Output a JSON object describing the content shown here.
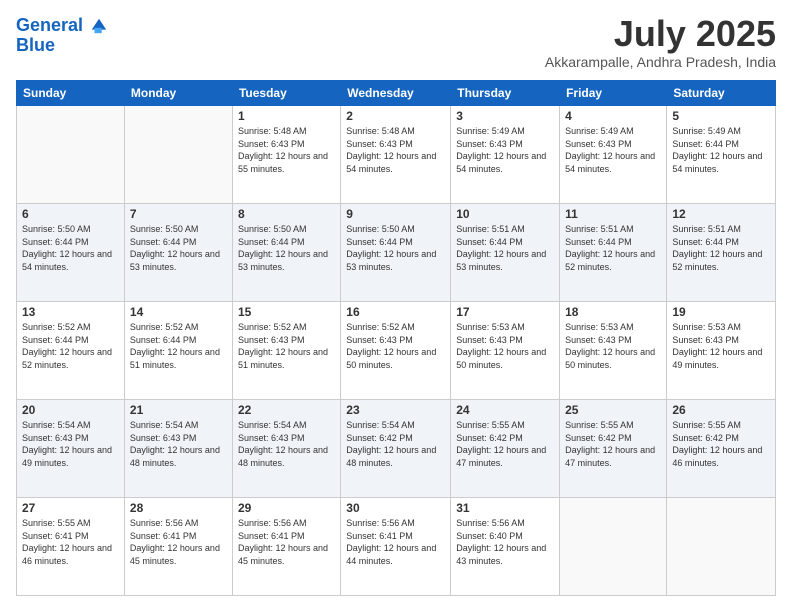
{
  "header": {
    "logo_line1": "General",
    "logo_line2": "Blue",
    "month_title": "July 2025",
    "location": "Akkarampalle, Andhra Pradesh, India"
  },
  "days_of_week": [
    "Sunday",
    "Monday",
    "Tuesday",
    "Wednesday",
    "Thursday",
    "Friday",
    "Saturday"
  ],
  "weeks": [
    [
      {
        "day": "",
        "info": ""
      },
      {
        "day": "",
        "info": ""
      },
      {
        "day": "1",
        "info": "Sunrise: 5:48 AM\nSunset: 6:43 PM\nDaylight: 12 hours and 55 minutes."
      },
      {
        "day": "2",
        "info": "Sunrise: 5:48 AM\nSunset: 6:43 PM\nDaylight: 12 hours and 54 minutes."
      },
      {
        "day": "3",
        "info": "Sunrise: 5:49 AM\nSunset: 6:43 PM\nDaylight: 12 hours and 54 minutes."
      },
      {
        "day": "4",
        "info": "Sunrise: 5:49 AM\nSunset: 6:43 PM\nDaylight: 12 hours and 54 minutes."
      },
      {
        "day": "5",
        "info": "Sunrise: 5:49 AM\nSunset: 6:44 PM\nDaylight: 12 hours and 54 minutes."
      }
    ],
    [
      {
        "day": "6",
        "info": "Sunrise: 5:50 AM\nSunset: 6:44 PM\nDaylight: 12 hours and 54 minutes."
      },
      {
        "day": "7",
        "info": "Sunrise: 5:50 AM\nSunset: 6:44 PM\nDaylight: 12 hours and 53 minutes."
      },
      {
        "day": "8",
        "info": "Sunrise: 5:50 AM\nSunset: 6:44 PM\nDaylight: 12 hours and 53 minutes."
      },
      {
        "day": "9",
        "info": "Sunrise: 5:50 AM\nSunset: 6:44 PM\nDaylight: 12 hours and 53 minutes."
      },
      {
        "day": "10",
        "info": "Sunrise: 5:51 AM\nSunset: 6:44 PM\nDaylight: 12 hours and 53 minutes."
      },
      {
        "day": "11",
        "info": "Sunrise: 5:51 AM\nSunset: 6:44 PM\nDaylight: 12 hours and 52 minutes."
      },
      {
        "day": "12",
        "info": "Sunrise: 5:51 AM\nSunset: 6:44 PM\nDaylight: 12 hours and 52 minutes."
      }
    ],
    [
      {
        "day": "13",
        "info": "Sunrise: 5:52 AM\nSunset: 6:44 PM\nDaylight: 12 hours and 52 minutes."
      },
      {
        "day": "14",
        "info": "Sunrise: 5:52 AM\nSunset: 6:44 PM\nDaylight: 12 hours and 51 minutes."
      },
      {
        "day": "15",
        "info": "Sunrise: 5:52 AM\nSunset: 6:43 PM\nDaylight: 12 hours and 51 minutes."
      },
      {
        "day": "16",
        "info": "Sunrise: 5:52 AM\nSunset: 6:43 PM\nDaylight: 12 hours and 50 minutes."
      },
      {
        "day": "17",
        "info": "Sunrise: 5:53 AM\nSunset: 6:43 PM\nDaylight: 12 hours and 50 minutes."
      },
      {
        "day": "18",
        "info": "Sunrise: 5:53 AM\nSunset: 6:43 PM\nDaylight: 12 hours and 50 minutes."
      },
      {
        "day": "19",
        "info": "Sunrise: 5:53 AM\nSunset: 6:43 PM\nDaylight: 12 hours and 49 minutes."
      }
    ],
    [
      {
        "day": "20",
        "info": "Sunrise: 5:54 AM\nSunset: 6:43 PM\nDaylight: 12 hours and 49 minutes."
      },
      {
        "day": "21",
        "info": "Sunrise: 5:54 AM\nSunset: 6:43 PM\nDaylight: 12 hours and 48 minutes."
      },
      {
        "day": "22",
        "info": "Sunrise: 5:54 AM\nSunset: 6:43 PM\nDaylight: 12 hours and 48 minutes."
      },
      {
        "day": "23",
        "info": "Sunrise: 5:54 AM\nSunset: 6:42 PM\nDaylight: 12 hours and 48 minutes."
      },
      {
        "day": "24",
        "info": "Sunrise: 5:55 AM\nSunset: 6:42 PM\nDaylight: 12 hours and 47 minutes."
      },
      {
        "day": "25",
        "info": "Sunrise: 5:55 AM\nSunset: 6:42 PM\nDaylight: 12 hours and 47 minutes."
      },
      {
        "day": "26",
        "info": "Sunrise: 5:55 AM\nSunset: 6:42 PM\nDaylight: 12 hours and 46 minutes."
      }
    ],
    [
      {
        "day": "27",
        "info": "Sunrise: 5:55 AM\nSunset: 6:41 PM\nDaylight: 12 hours and 46 minutes."
      },
      {
        "day": "28",
        "info": "Sunrise: 5:56 AM\nSunset: 6:41 PM\nDaylight: 12 hours and 45 minutes."
      },
      {
        "day": "29",
        "info": "Sunrise: 5:56 AM\nSunset: 6:41 PM\nDaylight: 12 hours and 45 minutes."
      },
      {
        "day": "30",
        "info": "Sunrise: 5:56 AM\nSunset: 6:41 PM\nDaylight: 12 hours and 44 minutes."
      },
      {
        "day": "31",
        "info": "Sunrise: 5:56 AM\nSunset: 6:40 PM\nDaylight: 12 hours and 43 minutes."
      },
      {
        "day": "",
        "info": ""
      },
      {
        "day": "",
        "info": ""
      }
    ]
  ]
}
